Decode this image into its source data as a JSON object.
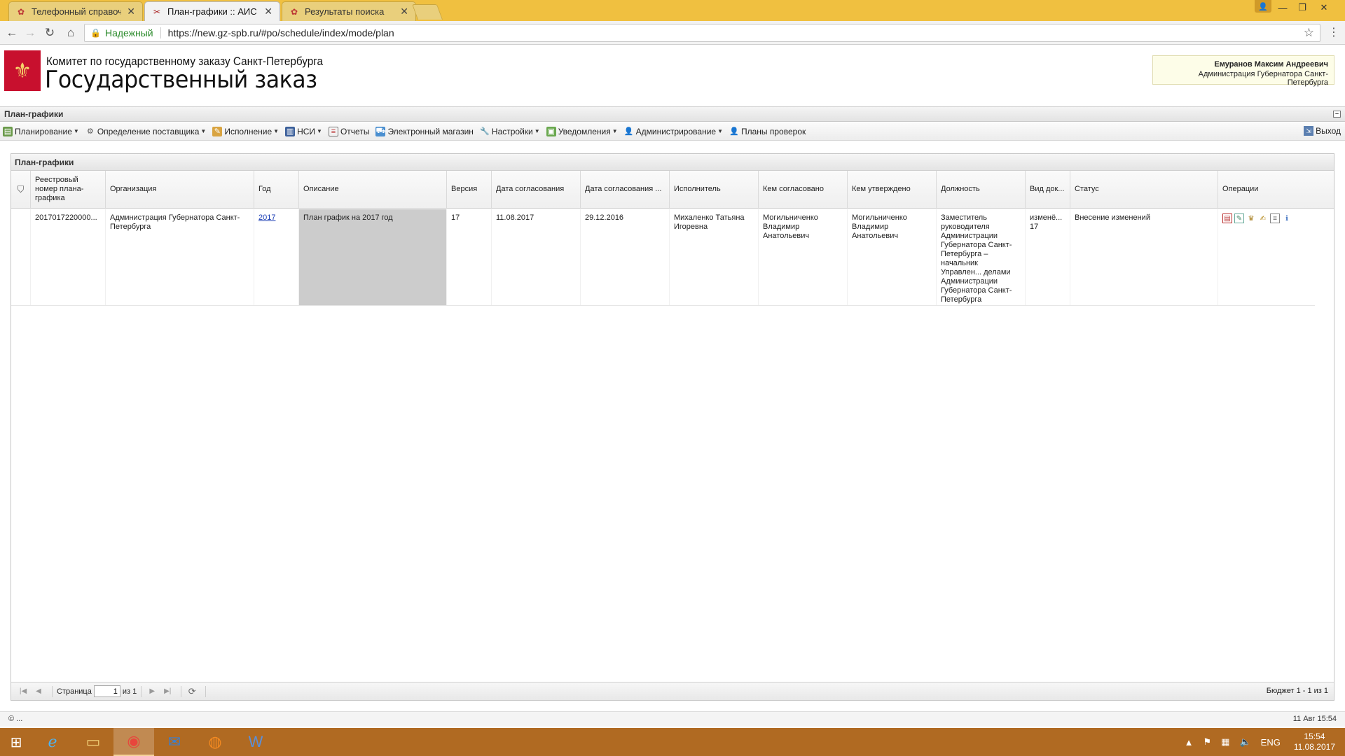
{
  "browser": {
    "tabs": [
      {
        "label": "Телефонный справочни",
        "icon": "seal-icon",
        "active": false
      },
      {
        "label": "План-графики :: АИС ГЗ",
        "icon": "tools-icon",
        "active": true
      },
      {
        "label": "Результаты поиска",
        "icon": "seal-icon",
        "active": false
      }
    ],
    "secure_label": "Надежный",
    "url": "https://new.gz-spb.ru/#po/schedule/index/mode/plan"
  },
  "header": {
    "org_line": "Комитет по государственному заказу Санкт-Петербурга",
    "system_title": "Государственный заказ",
    "user_name": "Емуранов Максим Андреевич",
    "user_org": "Администрация Губернатора Санкт-Петербурга"
  },
  "module_title": "План-графики",
  "toolbar": {
    "items": [
      {
        "label": "Планирование",
        "icon": "planning-icon",
        "dropdown": true
      },
      {
        "label": "Определение поставщика",
        "icon": "gears-icon",
        "dropdown": true
      },
      {
        "label": "Исполнение",
        "icon": "execution-icon",
        "dropdown": true
      },
      {
        "label": "НСИ",
        "icon": "book-icon",
        "dropdown": true
      },
      {
        "label": "Отчеты",
        "icon": "report-icon",
        "dropdown": false
      },
      {
        "label": "Электронный магазин",
        "icon": "cart-icon",
        "dropdown": false
      },
      {
        "label": "Настройки",
        "icon": "wrench-icon",
        "dropdown": true
      },
      {
        "label": "Уведомления",
        "icon": "notification-icon",
        "dropdown": true
      },
      {
        "label": "Администрирование",
        "icon": "admin-user-icon",
        "dropdown": true
      },
      {
        "label": "Планы проверок",
        "icon": "inspector-icon",
        "dropdown": false
      }
    ],
    "logout": "Выход"
  },
  "grid": {
    "title": "План-графики",
    "columns": [
      "",
      "Реестровый номер плана-графика",
      "Организация",
      "Год",
      "Описание",
      "Версия",
      "Дата согласования",
      "Дата согласования ...",
      "Исполнитель",
      "Кем согласовано",
      "Кем утверждено",
      "Должность",
      "Вид док...",
      "Статус",
      "Операции"
    ],
    "rows": [
      {
        "reg_no": "2017017220000...",
        "org": "Администрация Губернатора Санкт-Петербурга",
        "year": "2017",
        "desc": "План график на 2017 год",
        "version": "17",
        "date1": "11.08.2017",
        "date2": "29.12.2016",
        "executor": "Михаленко Татьяна Игоревна",
        "agreed_by": "Могильниченко Владимир Анатольевич",
        "approved_by": "Могильниченко Владимир Анатольевич",
        "position": "Заместитель руководителя Администрации Губернатора Санкт-Петербурга – начальник Управлен... делами Администрации Губернатора Санкт-Петербурга",
        "doc_type": "изменё... 17",
        "status": "Внесение изменений"
      }
    ]
  },
  "pager": {
    "page_label": "Страница",
    "page": "1",
    "of_label": "из 1",
    "info": "Бюджет 1 - 1 из 1"
  },
  "status_line": {
    "left": "© ...",
    "right": "11 Авг 15:54"
  },
  "taskbar": {
    "lang": "ENG",
    "time": "15:54",
    "date": "11.08.2017"
  },
  "colors": {
    "chrome_frame": "#f0c040",
    "taskbar": "#b06a22",
    "link": "#1b3eb5",
    "selected_cell": "#cccccc",
    "logo": "#c8102e"
  }
}
